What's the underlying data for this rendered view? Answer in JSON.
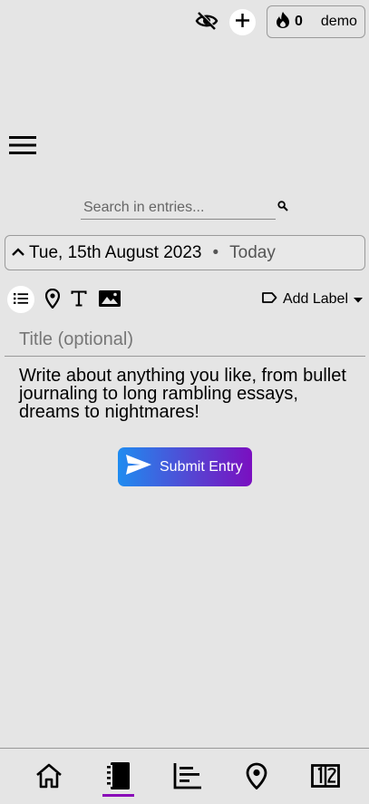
{
  "header": {
    "hide_icon": "eye-off-icon",
    "add_icon": "plus-icon",
    "streak": {
      "icon": "flame-icon",
      "count": "0"
    },
    "username": "demo"
  },
  "menu": {
    "icon": "hamburger-icon"
  },
  "search": {
    "placeholder": "Search in entries...",
    "value": "",
    "icon": "magnifier-icon"
  },
  "date_bar": {
    "collapse_icon": "chevron-up-icon",
    "date": "Tue, 15th August 2023",
    "separator": "•",
    "relative": "Today"
  },
  "toolbar": {
    "tools": [
      "list-icon",
      "location-pin-icon",
      "text-icon",
      "image-icon"
    ],
    "label_button": "Add Label"
  },
  "entry": {
    "title_placeholder": "Title (optional)",
    "body_placeholder": "Write about anything you like, from bullet journaling to long rambling essays, dreams to nightmares!",
    "submit_label": "Submit Entry"
  },
  "bottom_nav": {
    "items": [
      "home-icon",
      "journal-icon",
      "stats-icon",
      "map-icon",
      "calendar-icon"
    ],
    "active": "journal-icon",
    "active_color": "#8a0ab8"
  },
  "colors": {
    "background": "#e5e5e5",
    "submit_gradient_start": "#1f8cf0",
    "submit_gradient_end": "#7a0fc0"
  }
}
